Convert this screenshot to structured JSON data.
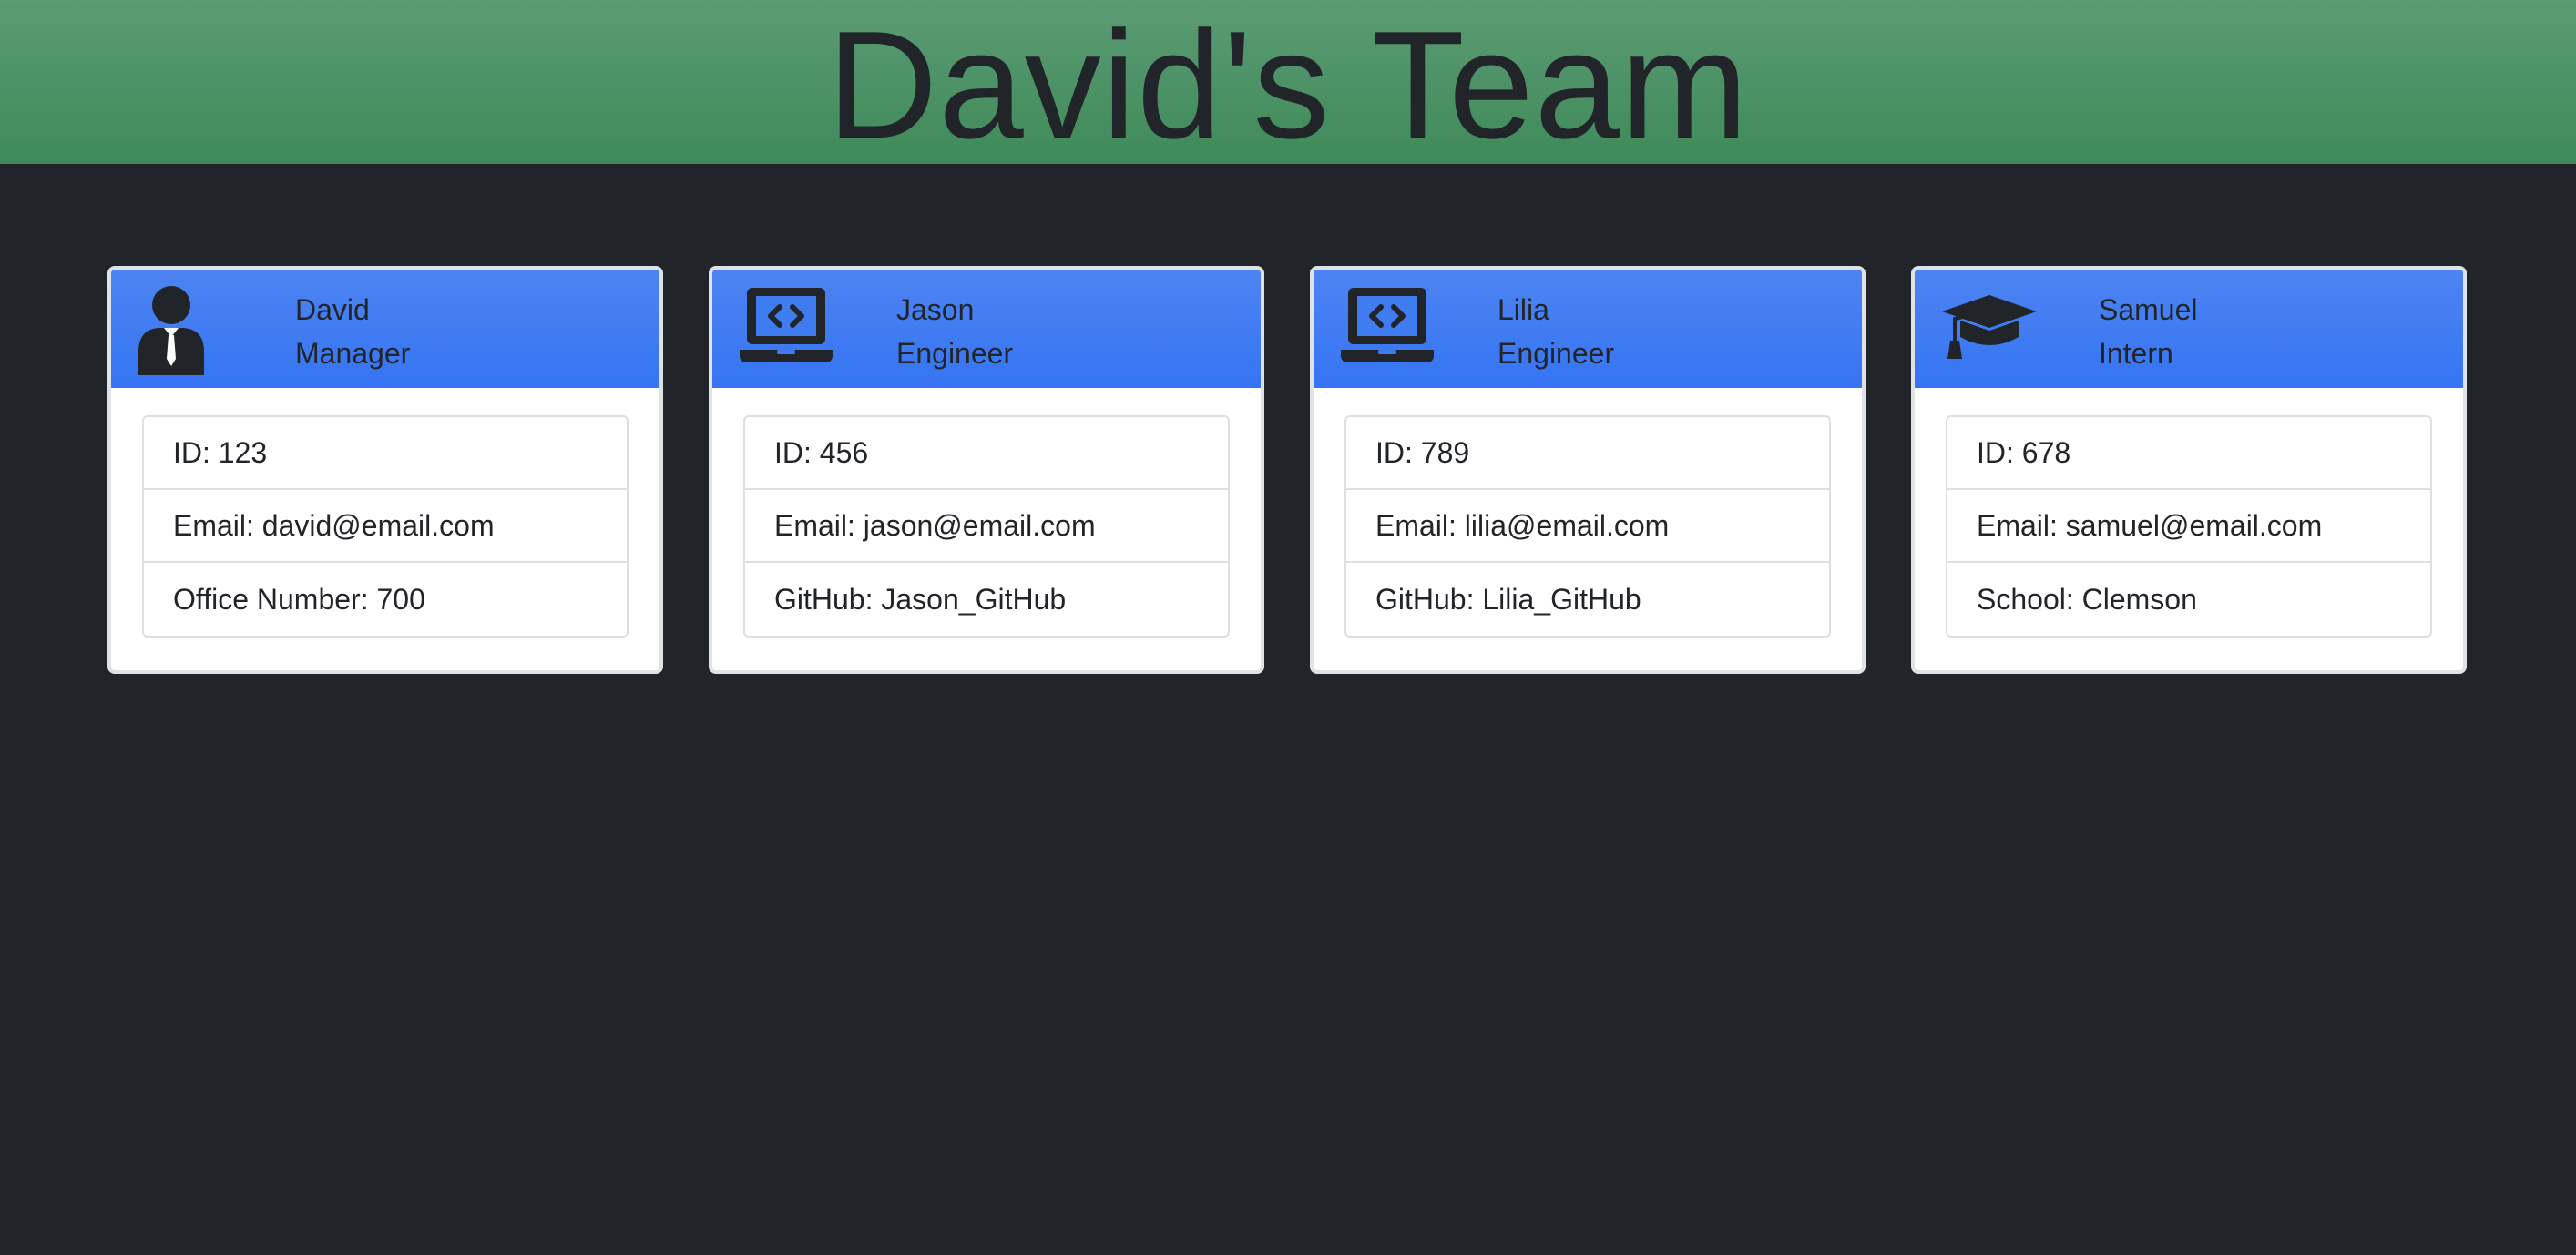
{
  "page": {
    "title": "David's Team"
  },
  "colors": {
    "header_bg": "#4a9163",
    "page_bg": "#212529",
    "card_header_bg": "#3f7cf2",
    "text": "#212529"
  },
  "team": [
    {
      "name": "David",
      "role": "Manager",
      "icon": "person-tie-icon",
      "details": [
        "ID: 123",
        "Email: david@email.com",
        "Office Number: 700"
      ]
    },
    {
      "name": "Jason",
      "role": "Engineer",
      "icon": "laptop-code-icon",
      "details": [
        "ID: 456",
        "Email: jason@email.com",
        "GitHub: Jason_GitHub"
      ]
    },
    {
      "name": "Lilia",
      "role": "Engineer",
      "icon": "laptop-code-icon",
      "details": [
        "ID: 789",
        "Email: lilia@email.com",
        "GitHub: Lilia_GitHub"
      ]
    },
    {
      "name": "Samuel",
      "role": "Intern",
      "icon": "graduation-cap-icon",
      "details": [
        "ID: 678",
        "Email: samuel@email.com",
        "School: Clemson"
      ]
    }
  ]
}
